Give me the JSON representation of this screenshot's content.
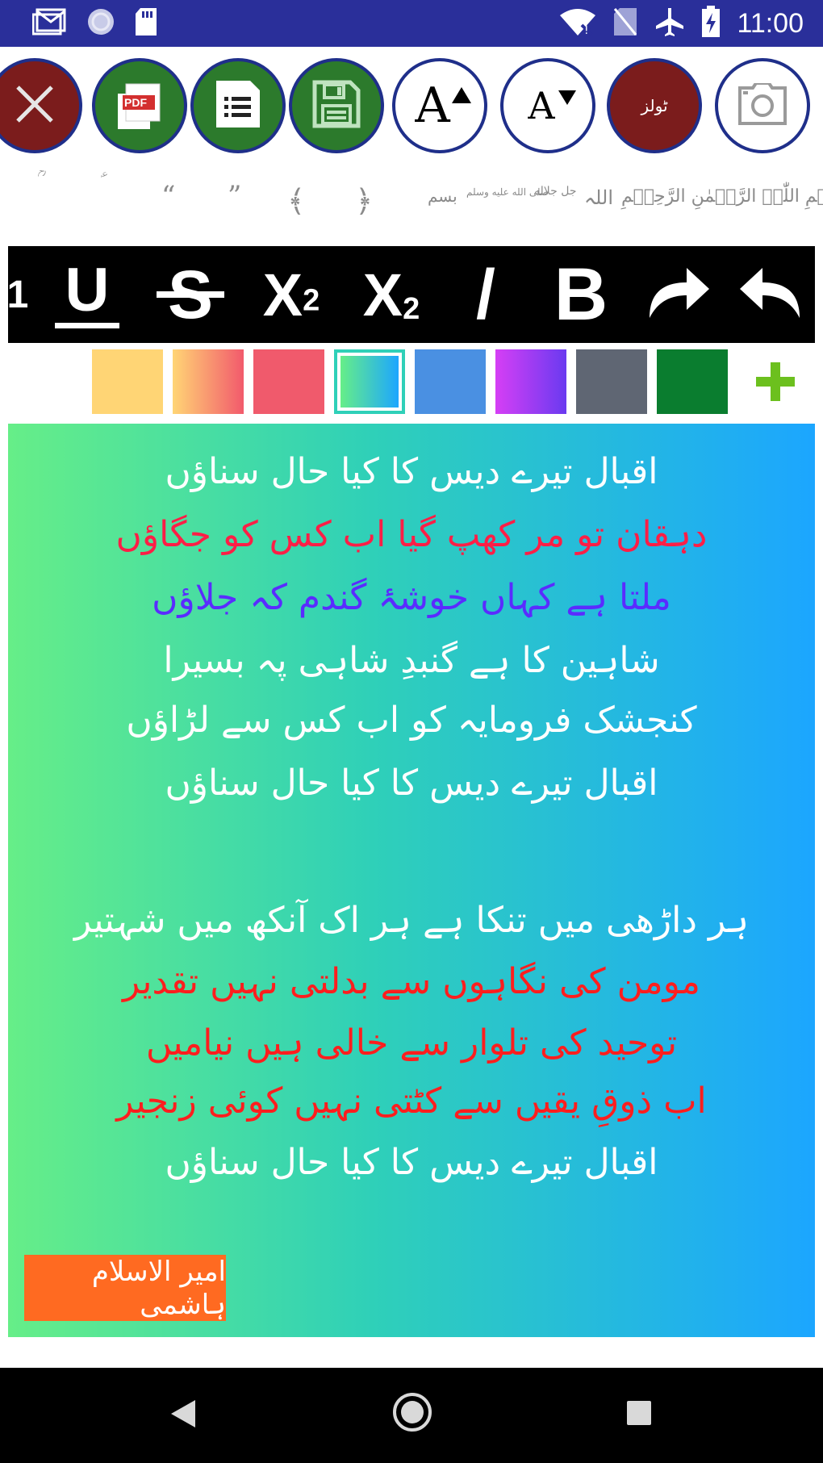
{
  "status_bar": {
    "time": "11:00",
    "left_icons": [
      "gmail-icon",
      "sync-icon",
      "sd-card-icon"
    ],
    "right_icons": [
      "wifi-icon",
      "no-sim-icon",
      "airplane-icon",
      "battery-charging-icon"
    ]
  },
  "toolbar": {
    "buttons": [
      "close-button",
      "pdf-button",
      "list-button",
      "save-button",
      "font-increase-button",
      "font-decrease-button",
      "tools-button",
      "camera-button"
    ],
    "font_increase_label": "A",
    "font_decrease_label": "A",
    "tools_label": "ٹولز",
    "pdf_label": "PDF"
  },
  "symbols": {
    "bismillah": "بِسۡمِ اللّٰہِ الرَّحۡمٰنِ الرَّحِيۡمِ",
    "allah": "اللہ",
    "jalla": "جل جلاله",
    "salla": "صلى الله عليه وسلم",
    "bismillah_short": "بسم",
    "ornate_paren_right": "﴿",
    "ornate_paren_left": "﴾",
    "quote_close": "”",
    "quote_open": "“",
    "ain": "ؑ",
    "ra": "ؒ"
  },
  "format_bar": {
    "partial_label": "1",
    "underline": "U",
    "strike": "S",
    "superscript_base": "X",
    "superscript_exp": "2",
    "subscript_base": "X",
    "subscript_exp": "2",
    "italic": "/",
    "bold": "B"
  },
  "colors": {
    "status_bar": "#2a2f9a",
    "close_red": "#7b1c1c",
    "action_green": "#2c7a2c",
    "circle_border": "#1f2f8a",
    "swatches": [
      "#ffd575",
      "linear-gradient(90deg,#ffd575,#f25a6c)",
      "#f05a6c",
      "linear-gradient(90deg,#66ee88,#1ca6ff)",
      "#4a90e2",
      "linear-gradient(90deg,#d63ff5,#6a3af0)",
      "#5f6673",
      "#0a7d2f"
    ],
    "selected_swatch_index": 3,
    "add_color": "#6cc01e",
    "signature_bg": "#ff6a21"
  },
  "editor": {
    "lines": [
      {
        "text": "اقبال تیرے دیس کا کیا حال سناؤں",
        "color": "#ffffff"
      },
      {
        "text": "دہقان تو مر کھپ گیا اب کس کو جگاؤں",
        "color": "#ff1e46"
      },
      {
        "text": "ملتا ہے کہاں خوشۂ گندم کہ جلاؤں",
        "color": "#5a2cff"
      },
      {
        "text": "شاہین کا ہے گنبدِ شاہی پہ بسیرا",
        "color": "#ffffff"
      },
      {
        "text": "کنجشک فرومایہ کو اب کس سے لڑاؤں",
        "color": "#ffffff"
      },
      {
        "text": "اقبال تیرے دیس کا کیا حال سناؤں",
        "color": "#ffffff"
      },
      {
        "text": "",
        "color": "#ffffff"
      },
      {
        "text": "ہر داڑھی میں تنکا ہے ہر اک آنکھ میں شہتیر",
        "color": "#ffffff"
      },
      {
        "text": "مومن کی نگاہوں سے بدلتی نہیں تقدیر",
        "color": "#ff1e1e"
      },
      {
        "text": "توحید کی تلوار سے خالی ہیں نیامیں",
        "color": "#ff1e1e"
      },
      {
        "text": "اب ذوقِ یقیں سے کٹتی نہیں کوئی زنجیر",
        "color": "#ff1e1e"
      },
      {
        "text": "اقبال تیرے دیس کا کیا حال سناؤں",
        "color": "#ffffff"
      }
    ],
    "signature": "امیر الاسلام ہاشمی"
  },
  "nav_bar": {
    "buttons": [
      "back-button",
      "home-button",
      "recents-button"
    ]
  }
}
